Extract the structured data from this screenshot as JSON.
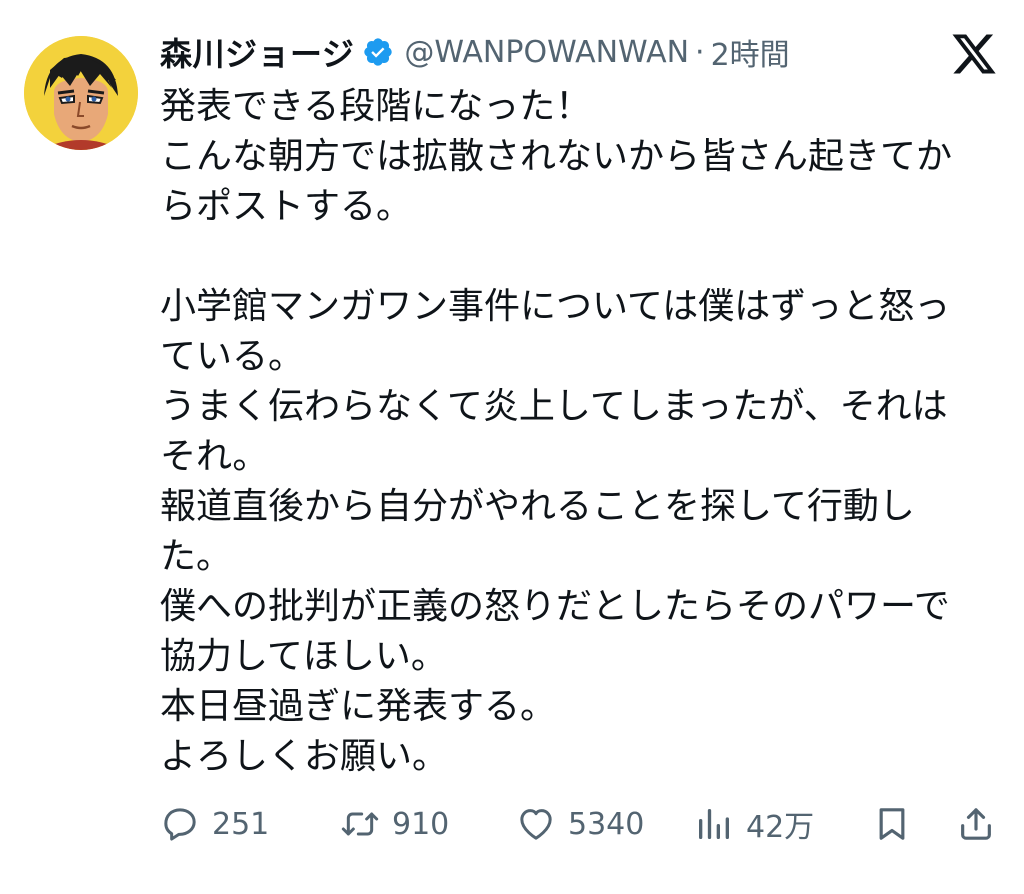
{
  "author": {
    "display_name": "森川ジョージ",
    "handle": "@WANPOWANWAN",
    "separator": "·",
    "time": "2時間",
    "verified": true,
    "verified_color": "#1d9bf0"
  },
  "post": {
    "lines": [
      "発表できる段階になった！",
      "こんな朝方では拡散されないから皆さん起きてか",
      "らポストする。",
      "",
      "小学館マンガワン事件については僕はずっと怒っ",
      "ている。",
      "うまく伝わらなくて炎上してしまったが、それは",
      "それ。",
      "報道直後から自分がやれることを探して行動し",
      "た。",
      "僕への批判が正義の怒りだとしたらそのパワーで",
      "協力してほしい。",
      "本日昼過ぎに発表する。",
      "よろしくお願い。"
    ]
  },
  "actions": {
    "replies": "251",
    "reposts": "910",
    "likes": "5340",
    "views": "42万"
  },
  "icons": {
    "reply": "speech-bubble-icon",
    "repost": "repost-arrows-icon",
    "like": "heart-icon",
    "views": "bar-chart-icon",
    "bookmark": "bookmark-icon",
    "share": "share-upload-icon",
    "brand": "x-logo-icon"
  },
  "colors": {
    "text": "#0f1419",
    "secondary": "#536471",
    "background": "#ffffff"
  }
}
